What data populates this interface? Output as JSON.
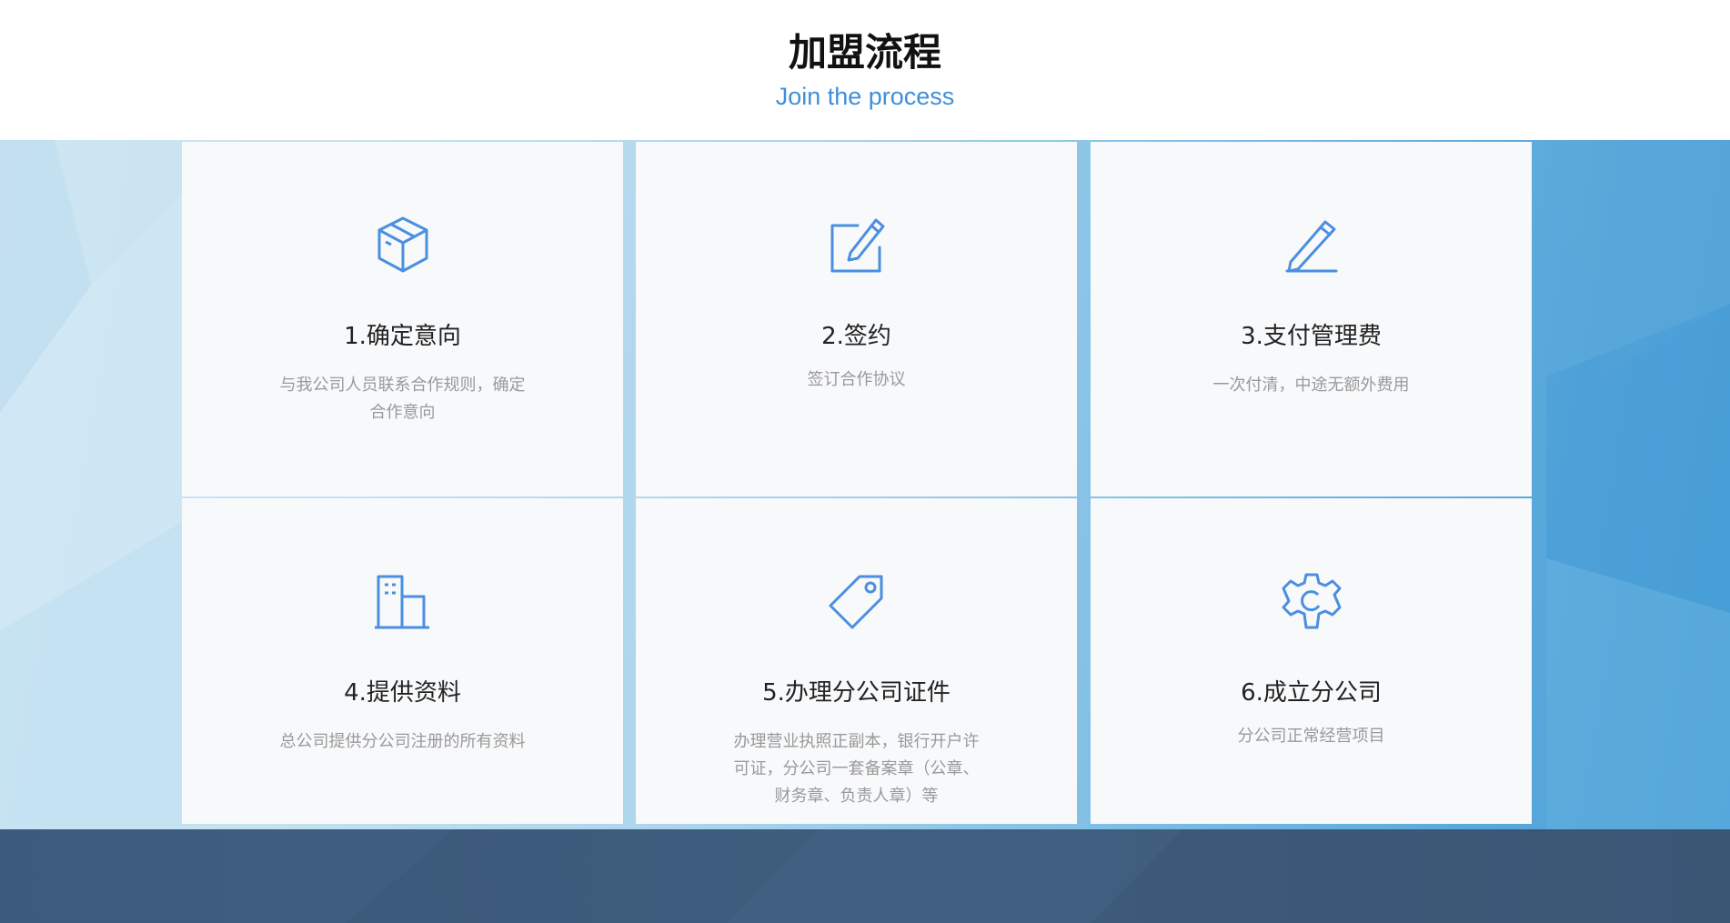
{
  "section": {
    "title": "加盟流程",
    "subtitle": "Join the process"
  },
  "steps": [
    {
      "title": "1.确定意向",
      "desc": "与我公司人员联系合作规则，确定合作意向",
      "icon": "box-icon"
    },
    {
      "title": "2.签约",
      "desc": "签订合作协议",
      "icon": "edit-icon"
    },
    {
      "title": "3.支付管理费",
      "desc": "一次付清，中途无额外费用",
      "icon": "pencil-icon"
    },
    {
      "title": "4.提供资料",
      "desc": "总公司提供分公司注册的所有资料",
      "icon": "building-icon"
    },
    {
      "title": "5.办理分公司证件",
      "desc": "办理营业执照正副本，银行开户许可证，分公司一套备案章（公章、财务章、负责人章）等",
      "icon": "tag-icon"
    },
    {
      "title": "6.成立分公司",
      "desc": "分公司正常经营项目",
      "icon": "gear-icon"
    }
  ],
  "colors": {
    "accent": "#3f8fdb",
    "icon": "#4a8fe0",
    "card": "#f8f9fb",
    "footer": "#3b5675"
  }
}
